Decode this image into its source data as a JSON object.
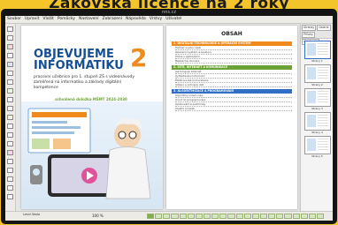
{
  "banner": {
    "text": "Zákovská licence na 2 roky"
  },
  "monitor": {
    "brand": "nns.cz"
  },
  "menubar": {
    "items": [
      "Soubor",
      "Upravit",
      "Vložit",
      "Pomůcky",
      "Nastavení",
      "Zobrazení",
      "Nápověda",
      "Vrstvy",
      "Uživatel"
    ]
  },
  "book": {
    "title_line1": "OBJEVUJEME",
    "title_line2": "INFORMATIKU",
    "number": "2",
    "subtitle": "pracovní učebnice pro 1. stupeň ZŠ s videonávody zaměřená na informatiku a základy digitální kompetence",
    "approval": "schválená doložka MŠMT 2024-2030",
    "toc_title": "OBSAH",
    "toc": [
      {
        "head": "1. DIGITÁLNÍ TECHNOLOGIE A OPERAČNÍ SYSTÉM",
        "color": "#f08a1c",
        "lines": [
          "Počítač a jeho části",
          "Operační systém a soubory",
          "Práce s aplikacemi",
          "Bezpečné chování"
        ]
      },
      {
        "head": "2. SÍTĚ, INTERNET A KOMUNIKACE",
        "color": "#6ba337",
        "lines": [
          "Jak funguje internet",
          "Vyhledávání informací",
          "Elektronická komunikace",
          "Sdílení a ochrana dat"
        ]
      },
      {
        "head": "3. ALGORITMIZACE A PROGRAMOVÁNÍ",
        "color": "#2f6ec4",
        "lines": [
          "Algoritmy kolem nás",
          "Úvod do programování",
          "Opakování a podmínky",
          "Vlastní projekt"
        ]
      }
    ]
  },
  "sidebar": {
    "tabs": [
      "Stránky",
      "Galerie",
      "Přílohy",
      "Vlastnosti"
    ],
    "pages": [
      "Strany 1",
      "Strany 2",
      "Strany 3",
      "Strany 4",
      "Strany 5"
    ]
  },
  "statusbar": {
    "text": "Lesní škola",
    "zoom": "100 %"
  },
  "colors": {
    "banner": "#f3c52a",
    "title": "#164f93",
    "accent_orange": "#f08a1c",
    "accent_green": "#6ba337"
  }
}
